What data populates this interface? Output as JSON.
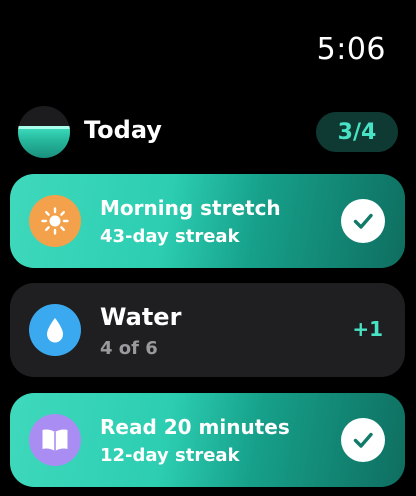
{
  "status_bar": {
    "time": "5:06"
  },
  "header": {
    "title": "Today",
    "progress": "3/4"
  },
  "habits": [
    {
      "title": "Morning stretch",
      "subtitle": "43-day streak",
      "icon": "sun-icon",
      "icon_color": "#f3a14a",
      "completed": true
    },
    {
      "title": "Water",
      "subtitle": "4 of 6",
      "icon": "water-drop-icon",
      "icon_color": "#3aa9f0",
      "completed": false,
      "action_label": "+1"
    },
    {
      "title": "Read 20 minutes",
      "subtitle": "12-day streak",
      "icon": "book-icon",
      "icon_color": "#a98df2",
      "completed": true
    }
  ],
  "colors": {
    "accent": "#48e2c5",
    "card_pending": "#1f1f21",
    "badge_bg": "#0f3a33"
  }
}
